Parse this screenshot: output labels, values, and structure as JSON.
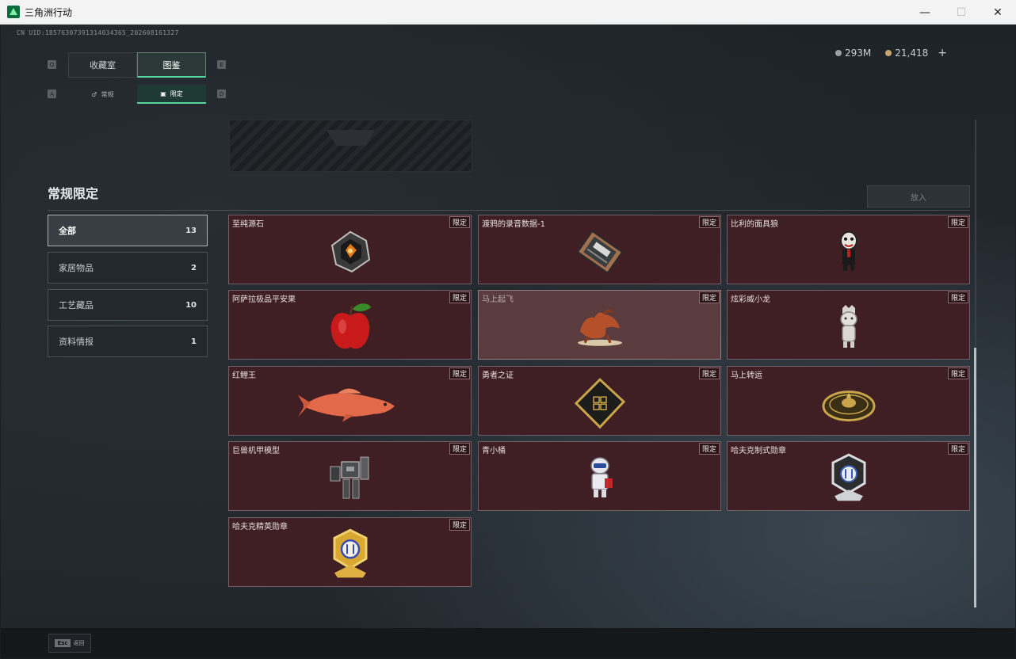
{
  "window": {
    "title": "三角洲行动",
    "minimize": "—",
    "maximize": "☐",
    "close": "✕"
  },
  "uid": "CN UID:18576307391314034365_202608161327",
  "currency": {
    "silver": "293M",
    "gold": "21,418",
    "plus": "+"
  },
  "main_tabs": {
    "key_left": "Q",
    "key_right": "E",
    "items": [
      {
        "label": "收藏室"
      },
      {
        "label": "图鉴"
      }
    ]
  },
  "sub_tabs": {
    "key_left": "A",
    "key_right": "D",
    "items": [
      {
        "label": "常规"
      },
      {
        "label": "限定"
      }
    ]
  },
  "section": {
    "title": "常规限定",
    "enter_label": "放入"
  },
  "categories": [
    {
      "label": "全部",
      "count": "13"
    },
    {
      "label": "家居物品",
      "count": "2"
    },
    {
      "label": "工艺藏品",
      "count": "10"
    },
    {
      "label": "资料情报",
      "count": "1"
    }
  ],
  "items": [
    {
      "name": "至纯源石",
      "badge": "限定",
      "icon": "gem-icon"
    },
    {
      "name": "渡鸦的录音数据-1",
      "badge": "限定",
      "icon": "data-card-icon"
    },
    {
      "name": "比利的面具狼",
      "badge": "限定",
      "icon": "puppet-icon"
    },
    {
      "name": "阿萨拉极品平安果",
      "badge": "限定",
      "icon": "apple-icon"
    },
    {
      "name": "马上起飞",
      "badge": "限定",
      "icon": "horse-icon"
    },
    {
      "name": "炫彩威小龙",
      "badge": "限定",
      "icon": "dragon-figure-icon"
    },
    {
      "name": "红鲤王",
      "badge": "限定",
      "icon": "carp-icon"
    },
    {
      "name": "勇者之证",
      "badge": "限定",
      "icon": "card-icon"
    },
    {
      "name": "马上转运",
      "badge": "限定",
      "icon": "compass-icon"
    },
    {
      "name": "巨兽机甲模型",
      "badge": "限定",
      "icon": "mech-icon"
    },
    {
      "name": "青小桶",
      "badge": "限定",
      "icon": "robot-figure-icon"
    },
    {
      "name": "哈夫克制式勋章",
      "badge": "限定",
      "icon": "silver-medal-icon"
    },
    {
      "name": "哈夫克精英勋章",
      "badge": "限定",
      "icon": "gold-medal-icon"
    }
  ],
  "footer": {
    "esc_key": "Esc",
    "esc_label": "返回"
  }
}
